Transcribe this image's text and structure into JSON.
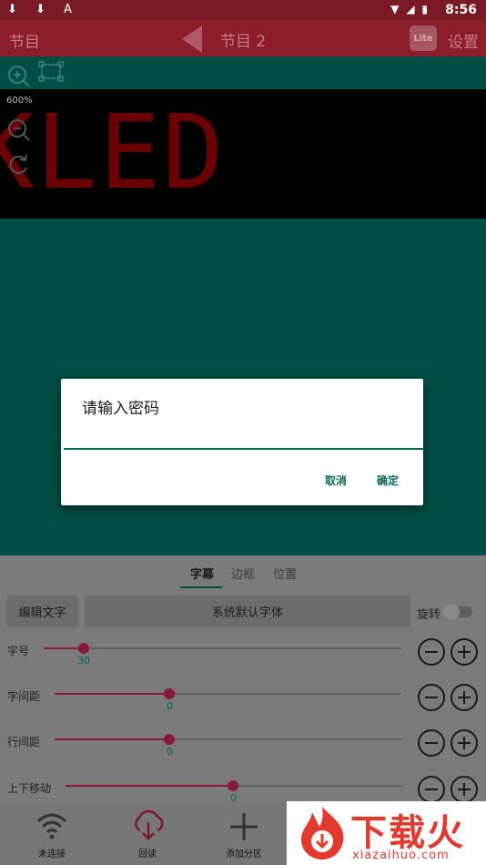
{
  "status_bar": {
    "time": "8:56",
    "left_icons": "⬇ ⬇ A",
    "right_icons": "▼ ◢ ▮"
  },
  "app_bar": {
    "left_title": "节目",
    "center_title": "节目 2",
    "badge": "Lite",
    "right_title": "设置"
  },
  "preview": {
    "zoom": "600%",
    "led_text": "KLED"
  },
  "dialog": {
    "title": "请输入密码",
    "input_value": "",
    "cancel": "取消",
    "confirm": "确定"
  },
  "tabs": [
    "字幕",
    "边框",
    "位置"
  ],
  "controls": {
    "edit_text": "编辑文字",
    "font": "系统默认字体",
    "rotate": "旋转"
  },
  "sliders": [
    {
      "label": "字号",
      "value": "30"
    },
    {
      "label": "字间距",
      "value": "0"
    },
    {
      "label": "行间距",
      "value": "0"
    },
    {
      "label": "上下移动",
      "value": "0"
    }
  ],
  "bottom_nav": [
    {
      "label": "未连接"
    },
    {
      "label": "回读"
    },
    {
      "label": "添加分区"
    }
  ],
  "watermark": {
    "big": "下载火",
    "small": "xiazaihuo.com"
  },
  "colors": {
    "accent": "#8a1a3a",
    "teal": "#024e44",
    "led_red": "#c00008"
  }
}
